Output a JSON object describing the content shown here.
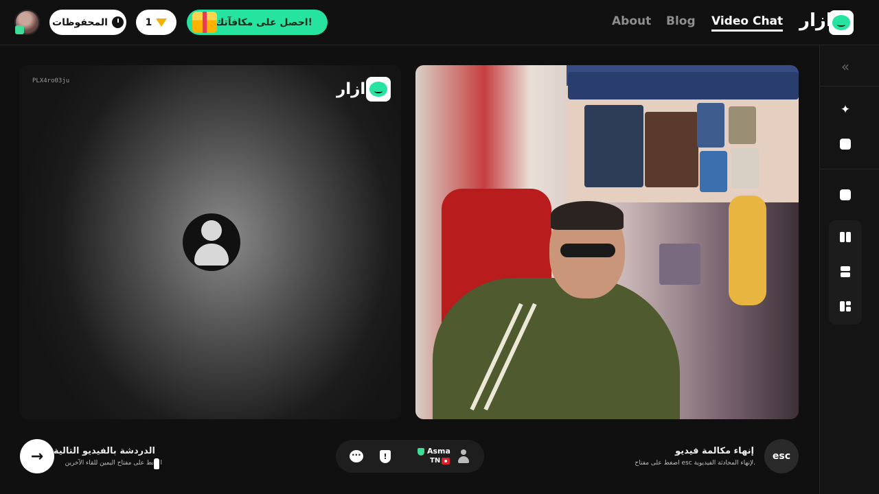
{
  "header": {
    "saved_label": "المحفوظات",
    "gems_count": "1",
    "reward_label": "احصل على مكافآتك!",
    "nav": [
      "About",
      "Blog",
      "Video Chat"
    ],
    "brand": "ازار"
  },
  "left_panel": {
    "user_id": "PLX4ro03ju",
    "brand": "ازار"
  },
  "bottom": {
    "next_title": "الدردشة بالفيديو التالية",
    "next_subtitle": "اضغط على مفتاح اليمين للقاء الآخرين",
    "partner_name": "Asma",
    "partner_country": "TN",
    "end_title": "إنهاء مكالمة فيديو",
    "end_subtitle": "اضغط على مفتاح esc لإنهاء المحادثة الفيديوية.",
    "esc_label": "esc"
  },
  "sidebar": {
    "collapse_icon": "«",
    "icons": [
      "magic-wand-icon",
      "emoji-icon",
      "minimize-icon",
      "layout-side-by-side-icon",
      "layout-stacked-icon",
      "layout-grid-icon"
    ]
  },
  "colors": {
    "accent": "#27e3a0",
    "background": "#101010",
    "gem": "#f5b100"
  }
}
